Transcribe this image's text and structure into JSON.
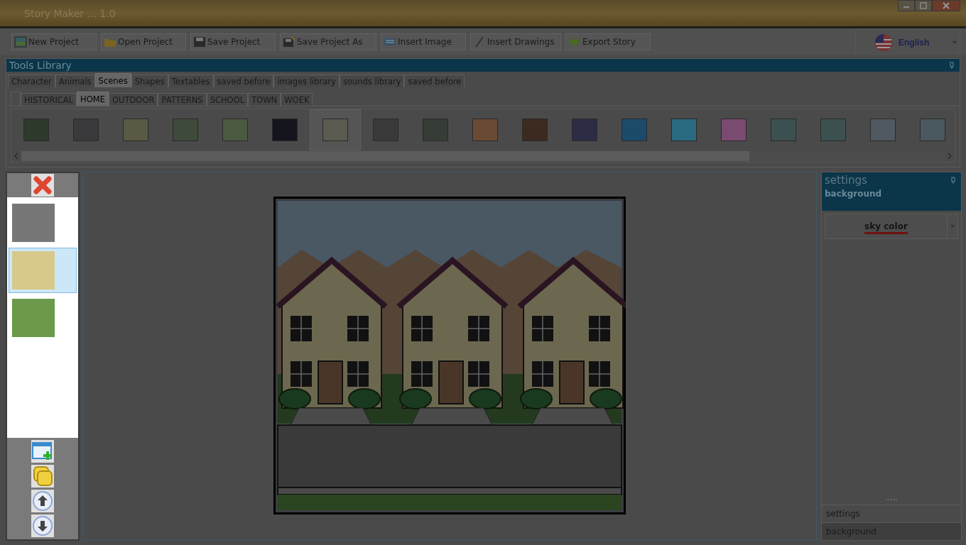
{
  "window": {
    "title": "Story Maker ... 1.0"
  },
  "toolbar": [
    {
      "label": "New Project",
      "kind": "new"
    },
    {
      "label": "Open Project",
      "kind": "open"
    },
    {
      "label": "Save Project",
      "kind": "save"
    },
    {
      "label": "Save Project As",
      "kind": "saveas"
    },
    {
      "label": "Insert Image",
      "kind": "image"
    },
    {
      "label": "Insert Drawings",
      "kind": "drawing"
    },
    {
      "label": "Export Story",
      "kind": "export"
    }
  ],
  "language": {
    "label": "English"
  },
  "tools_library": {
    "title": "Tools Library",
    "tabs": [
      {
        "label": "Character",
        "selected": false
      },
      {
        "label": "Animals",
        "selected": false
      },
      {
        "label": "Scenes",
        "selected": true
      },
      {
        "label": "Shapes",
        "selected": false
      },
      {
        "label": "Textables",
        "selected": false
      },
      {
        "label": "saved before",
        "selected": false
      },
      {
        "label": "images library",
        "selected": false
      },
      {
        "label": "sounds library",
        "selected": false
      },
      {
        "label": "saved before",
        "selected": false
      }
    ],
    "subtabs": [
      {
        "label": "HISTORICAL",
        "selected": false
      },
      {
        "label": "HOME",
        "selected": true
      },
      {
        "label": "OUTDOOR",
        "selected": false
      },
      {
        "label": "PATTERNS",
        "selected": false
      },
      {
        "label": "SCHOOL",
        "selected": false
      },
      {
        "label": "TOWN",
        "selected": false
      },
      {
        "label": "WOEK",
        "selected": false
      }
    ],
    "thumbnails": [
      {
        "selected": false
      },
      {
        "selected": false
      },
      {
        "selected": false
      },
      {
        "selected": false
      },
      {
        "selected": false
      },
      {
        "selected": false
      },
      {
        "selected": true
      },
      {
        "selected": false
      },
      {
        "selected": false
      },
      {
        "selected": false
      },
      {
        "selected": false
      },
      {
        "selected": false
      },
      {
        "selected": false
      },
      {
        "selected": false
      },
      {
        "selected": false
      },
      {
        "selected": false
      },
      {
        "selected": false
      },
      {
        "selected": false
      },
      {
        "selected": false
      }
    ]
  },
  "slides": [
    {
      "selected": false
    },
    {
      "selected": true
    },
    {
      "selected": false
    }
  ],
  "settings": {
    "title": "settings",
    "subtitle": "background",
    "dropdown": "sky color",
    "tabs": [
      {
        "label": "settings",
        "selected": false
      },
      {
        "label": "background",
        "selected": true
      }
    ]
  }
}
